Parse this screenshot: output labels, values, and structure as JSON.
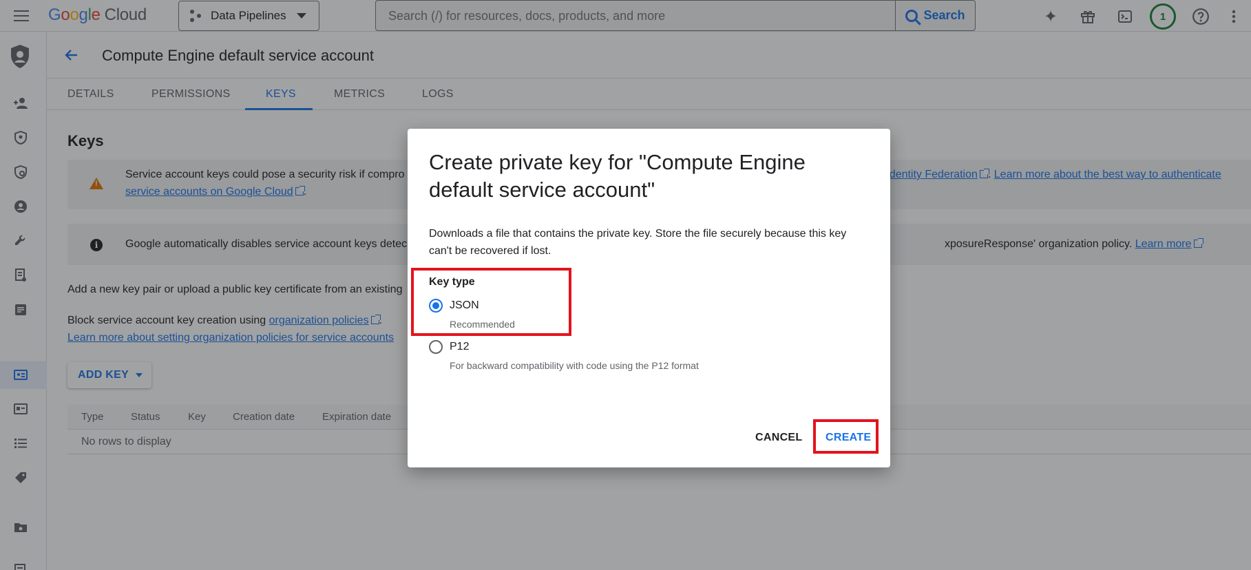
{
  "topbar": {
    "logo_google": "Google",
    "logo_cloud": "Cloud",
    "project": "Data Pipelines",
    "search_placeholder": "Search (/) for resources, docs, products, and more",
    "search_button": "Search",
    "notification_count": "1"
  },
  "header": {
    "title": "Compute Engine default service account"
  },
  "tabs": [
    "DETAILS",
    "PERMISSIONS",
    "KEYS",
    "METRICS",
    "LOGS"
  ],
  "content": {
    "heading": "Keys",
    "warning_line1_start": "Service account keys could pose a security risk if compro",
    "warning_link_federation": "d Identity Federation",
    "warning_mid": ". ",
    "warning_link_learn": "Learn more about the best way to authenticate",
    "warning_link_line2": "service accounts on Google Cloud",
    "warning_end": ".",
    "info_start": "Google automatically disables service account keys detec",
    "info_end": "xposureResponse' organization policy. ",
    "info_link": "Learn more",
    "add_para": "Add a new key pair or upload a public key certificate from an existing",
    "block_start": "Block service account key creation using ",
    "block_link": "organization policies",
    "block_end": ".",
    "learn_link": "Learn more about setting organization policies for service accounts",
    "add_key_button": "ADD KEY",
    "table_headers": [
      "Type",
      "Status",
      "Key",
      "Creation date",
      "Expiration date"
    ],
    "empty_message": "No rows to display"
  },
  "dialog": {
    "title": "Create private key for \"Compute Engine default service account\"",
    "description": "Downloads a file that contains the private key. Store the file securely because this key can't be recovered if lost.",
    "key_type_label": "Key type",
    "options": [
      {
        "label": "JSON",
        "sublabel": "Recommended",
        "selected": true
      },
      {
        "label": "P12",
        "sublabel": "For backward compatibility with code using the P12 format",
        "selected": false
      }
    ],
    "cancel_label": "CANCEL",
    "create_label": "CREATE"
  },
  "colors": {
    "accent": "#1a73e8",
    "highlight": "#e3131d",
    "warning": "#e37400"
  }
}
